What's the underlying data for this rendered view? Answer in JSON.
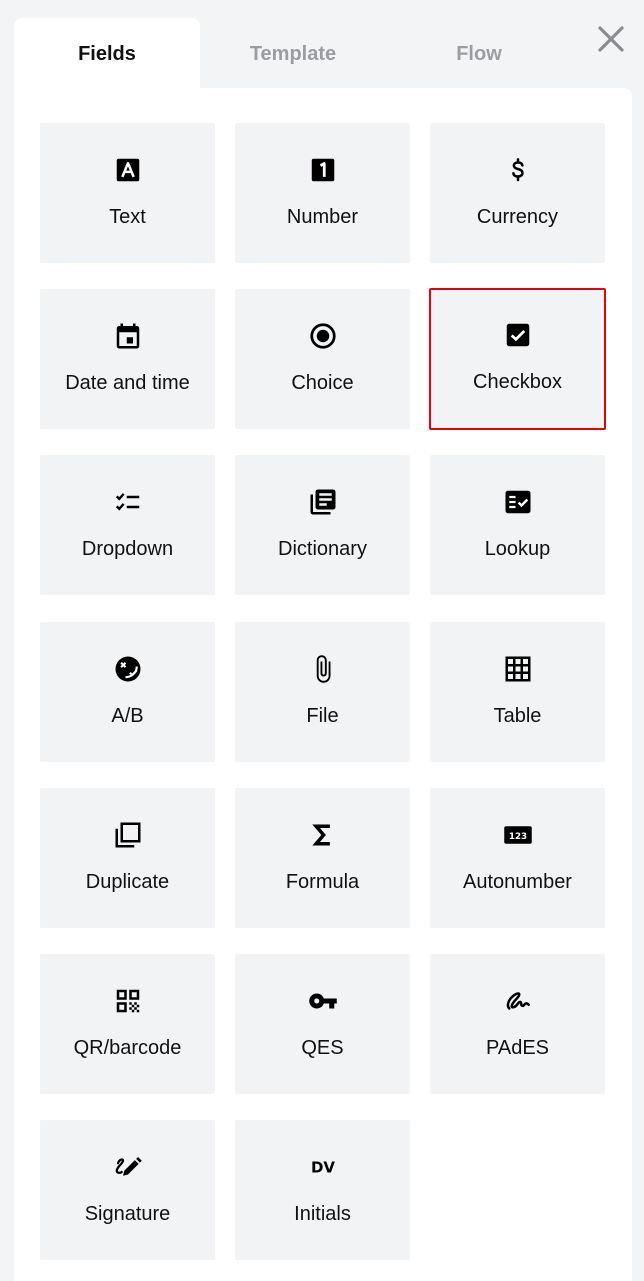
{
  "tabs": [
    {
      "label": "Fields",
      "active": true
    },
    {
      "label": "Template",
      "active": false
    },
    {
      "label": "Flow",
      "active": false
    }
  ],
  "close_icon": "close-icon",
  "selected_color": "#e0060e",
  "fields": [
    {
      "label": "Text",
      "icon": "text-field-icon"
    },
    {
      "label": "Number",
      "icon": "number-icon"
    },
    {
      "label": "Currency",
      "icon": "dollar-icon"
    },
    {
      "label": "Date and time",
      "icon": "calendar-icon"
    },
    {
      "label": "Choice",
      "icon": "radio-button-icon"
    },
    {
      "label": "Checkbox",
      "icon": "checkbox-icon",
      "selected": true
    },
    {
      "label": "Dropdown",
      "icon": "checklist-icon"
    },
    {
      "label": "Dictionary",
      "icon": "library-books-icon"
    },
    {
      "label": "Lookup",
      "icon": "fact-check-icon"
    },
    {
      "label": "A/B",
      "icon": "ab-face-icon"
    },
    {
      "label": "File",
      "icon": "paperclip-icon"
    },
    {
      "label": "Table",
      "icon": "table-grid-icon"
    },
    {
      "label": "Duplicate",
      "icon": "copy-icon"
    },
    {
      "label": "Formula",
      "icon": "sigma-icon"
    },
    {
      "label": "Autonumber",
      "icon": "autonumber-123-icon"
    },
    {
      "label": "QR/barcode",
      "icon": "qr-code-icon"
    },
    {
      "label": "QES",
      "icon": "key-icon"
    },
    {
      "label": "PAdES",
      "icon": "signature-scribble-icon"
    },
    {
      "label": "Signature",
      "icon": "pen-signature-icon"
    },
    {
      "label": "Initials",
      "icon": "initials-dv-icon"
    }
  ],
  "icon_text": {
    "autonumber": "123",
    "initials": "DV"
  }
}
